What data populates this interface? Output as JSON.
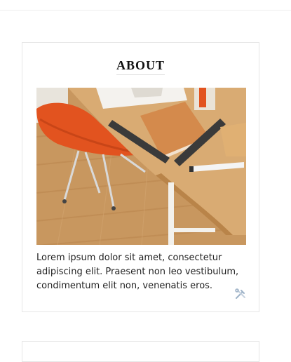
{
  "about_widget": {
    "title": "ABOUT",
    "image_alt": "Workspace desk with notebook, rulers and orange chair",
    "body_text": "Lorem ipsum dolor sit amet, consectetur adipiscing elit. Praesent non leo vestibulum, condimentum elit non, venenatis eros.",
    "tools_icon": "tools-icon"
  }
}
